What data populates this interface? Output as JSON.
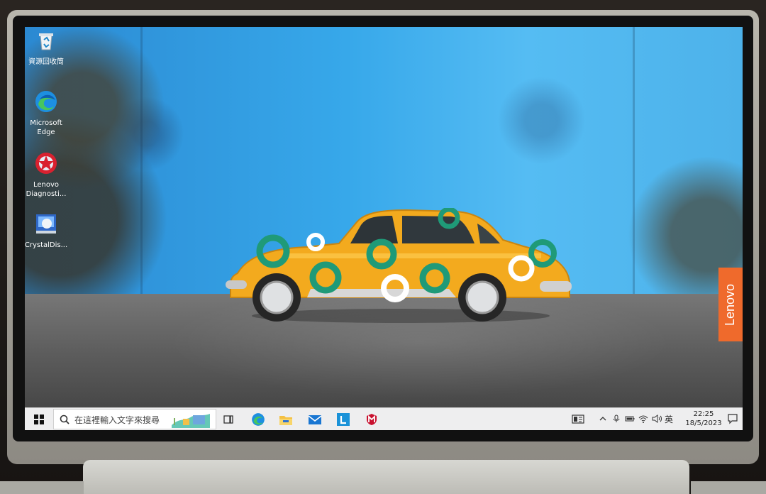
{
  "desktop": {
    "icons": [
      {
        "label": "資源回收筒",
        "icon": "recycle-bin-icon"
      },
      {
        "label": "Microsoft Edge",
        "icon": "edge-icon"
      },
      {
        "label": "Lenovo Diagnosti...",
        "icon": "lenovo-diagnostics-icon"
      },
      {
        "label": "CrystalDis...",
        "icon": "crystaldisk-icon"
      }
    ],
    "brand_label": "Lenovo"
  },
  "taskbar": {
    "search_placeholder": "在這裡輸入文字來搜尋",
    "apps": [
      "task-view-icon",
      "edge-icon",
      "file-explorer-icon",
      "mail-icon",
      "lenovo-app-icon",
      "mcafee-icon"
    ],
    "tray": {
      "input_method": "英",
      "time": "22:25",
      "date": "18/5/2023"
    }
  },
  "colors": {
    "accent": "#0078d4",
    "brand": "#ef6a2c",
    "car": "#f7b628",
    "green_spots": "#1f9a78"
  }
}
